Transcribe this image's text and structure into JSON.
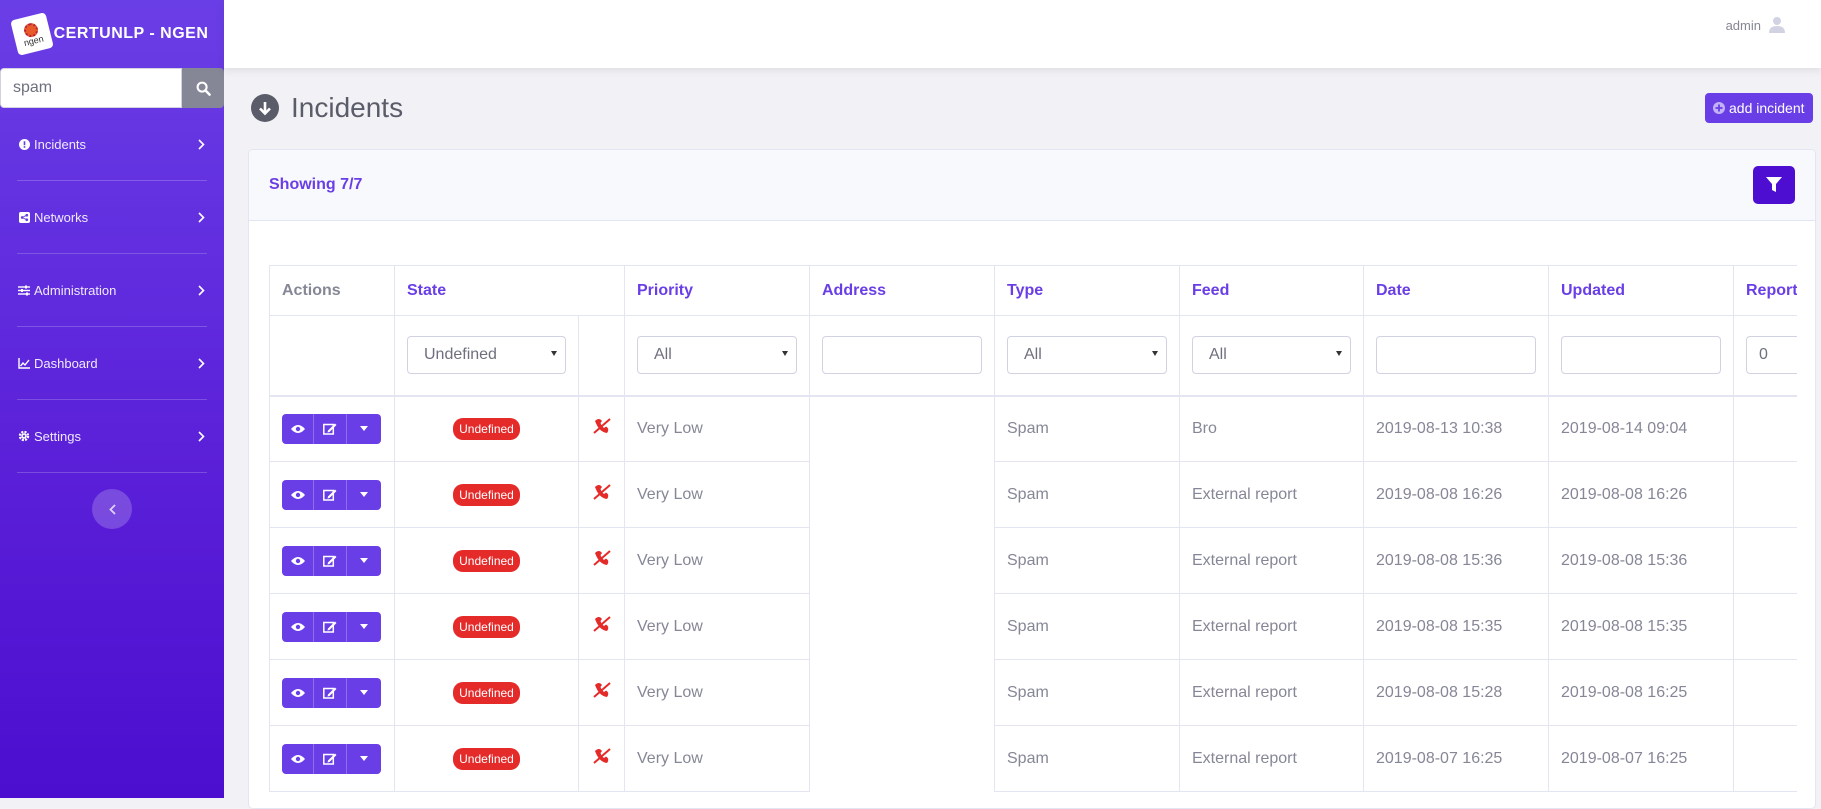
{
  "brand": {
    "title": "CERTUNLP - NGEN",
    "logo_text": "ngen"
  },
  "search": {
    "value": "spam"
  },
  "sidebar": {
    "items": [
      {
        "label": "Incidents",
        "icon": "exclamation-circle-icon"
      },
      {
        "label": "Networks",
        "icon": "share-alt-square-icon"
      },
      {
        "label": "Administration",
        "icon": "sliders-icon"
      },
      {
        "label": "Dashboard",
        "icon": "chart-line-icon"
      },
      {
        "label": "Settings",
        "icon": "cog-icon"
      }
    ]
  },
  "topbar": {
    "user": "admin"
  },
  "page": {
    "title": "Incidents",
    "add_label": "add incident"
  },
  "card": {
    "showing": "Showing 7/7"
  },
  "table": {
    "headers": [
      "Actions",
      "State",
      "Priority",
      "Address",
      "Type",
      "Feed",
      "Date",
      "Updated",
      "Report"
    ],
    "filters": {
      "state": "Undefined",
      "priority": "All",
      "type": "All",
      "feed": "All",
      "report": "0"
    },
    "rows": [
      {
        "state": "Undefined",
        "priority": "Very Low",
        "type": "Spam",
        "feed": "Bro",
        "date": "2019-08-13 10:38",
        "updated": "2019-08-14 09:04"
      },
      {
        "state": "Undefined",
        "priority": "Very Low",
        "type": "Spam",
        "feed": "External report",
        "date": "2019-08-08 16:26",
        "updated": "2019-08-08 16:26"
      },
      {
        "state": "Undefined",
        "priority": "Very Low",
        "type": "Spam",
        "feed": "External report",
        "date": "2019-08-08 15:36",
        "updated": "2019-08-08 15:36"
      },
      {
        "state": "Undefined",
        "priority": "Very Low",
        "type": "Spam",
        "feed": "External report",
        "date": "2019-08-08 15:35",
        "updated": "2019-08-08 15:35"
      },
      {
        "state": "Undefined",
        "priority": "Very Low",
        "type": "Spam",
        "feed": "External report",
        "date": "2019-08-08 15:28",
        "updated": "2019-08-08 16:25"
      },
      {
        "state": "Undefined",
        "priority": "Very Low",
        "type": "Spam",
        "feed": "External report",
        "date": "2019-08-07 16:25",
        "updated": "2019-08-07 16:25"
      }
    ]
  },
  "colors": {
    "primary": "#6a3ee6",
    "badge": "#e52a2a",
    "sidebar_bottom": "#4c0ecf"
  }
}
